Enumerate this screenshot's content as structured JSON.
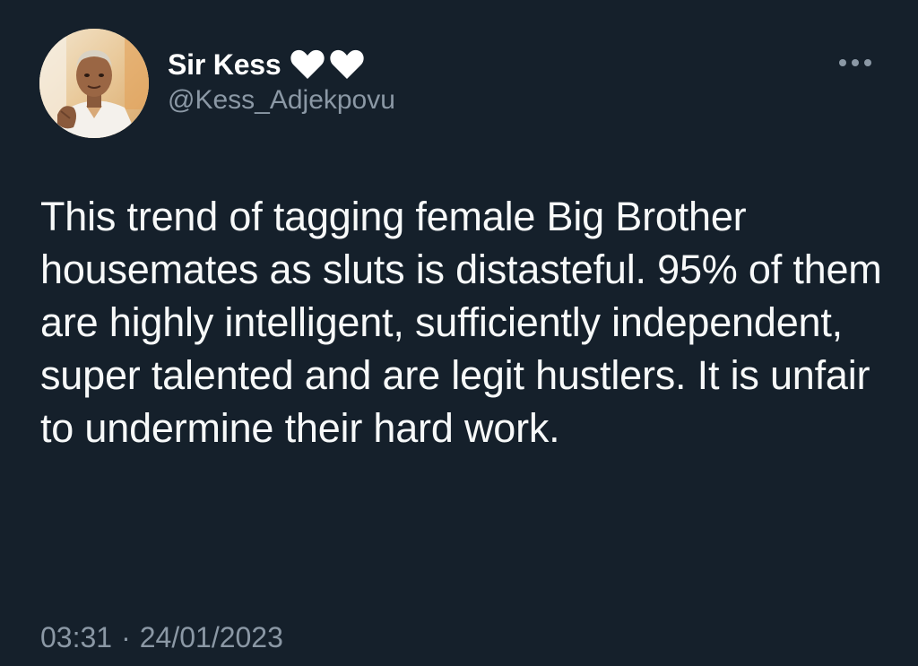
{
  "author": {
    "display_name": "Sir Kess",
    "badge_icons": [
      "white-heart-icon",
      "white-heart-icon"
    ],
    "handle": "@Kess_Adjekpovu"
  },
  "tweet": {
    "text": "This trend of tagging female Big Brother housemates as sluts is distasteful. 95% of them are highly intelligent, sufficiently independent, super talented and are legit hustlers. It is unfair to undermine their hard work."
  },
  "meta": {
    "time": "03:31",
    "separator": "·",
    "date": "24/01/2023"
  },
  "colors": {
    "background": "#15202b",
    "primary_text": "#ffffff",
    "secondary_text": "#8b98a5"
  }
}
